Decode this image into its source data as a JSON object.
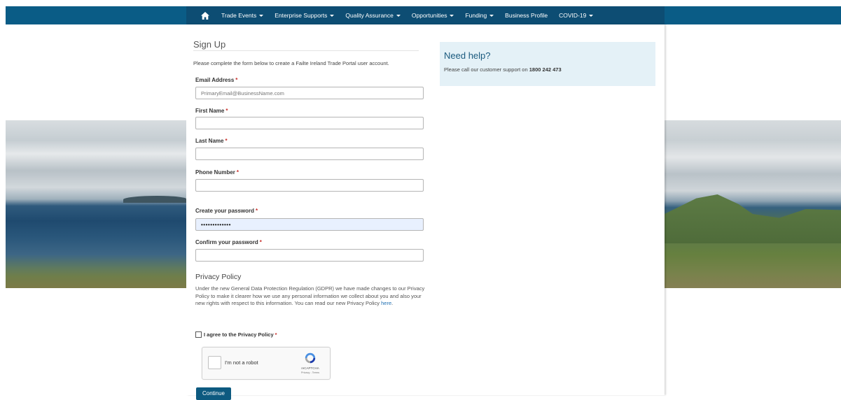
{
  "nav": {
    "home_icon": "home-icon",
    "items": [
      {
        "label": "Trade Events",
        "dropdown": true
      },
      {
        "label": "Enterprise Supports",
        "dropdown": true
      },
      {
        "label": "Quality Assurance",
        "dropdown": true
      },
      {
        "label": "Opportunities",
        "dropdown": true
      },
      {
        "label": "Funding",
        "dropdown": true
      },
      {
        "label": "Business Profile",
        "dropdown": false
      },
      {
        "label": "COVID-19",
        "dropdown": true
      }
    ]
  },
  "form": {
    "title": "Sign Up",
    "intro": "Please complete the form below to create a Failte Ireland Trade Portal user account.",
    "required_marker": "*",
    "email": {
      "label": "Email Address",
      "placeholder": "PrimaryEmail@BusinessName.com",
      "value": ""
    },
    "first_name": {
      "label": "First Name",
      "value": ""
    },
    "last_name": {
      "label": "Last Name",
      "value": ""
    },
    "phone": {
      "label": "Phone Number",
      "value": ""
    },
    "password": {
      "label": "Create your password",
      "value": "•••••••••••••"
    },
    "confirm_password": {
      "label": "Confirm your password",
      "value": ""
    }
  },
  "privacy": {
    "title": "Privacy Policy",
    "text": "Under the new General Data Protection Regulation (GDPR) we have made changes to our Privacy Policy to make it clearer how we use any personal information we collect about you and also your new rights with respect to this information. You can read our new Privacy Policy",
    "link": "here",
    "agree_label": "I agree to the Privacy Policy",
    "required_marker": "*"
  },
  "recaptcha": {
    "label": "I'm not a robot",
    "brand": "reCAPTCHA",
    "sub": "Privacy - Terms"
  },
  "continue_label": "Continue",
  "help": {
    "title": "Need help?",
    "text": "Please call our customer support on",
    "phone": "1800 242 473"
  },
  "colors": {
    "nav_outer": "#0a5c86",
    "nav_inner": "#0d4d73",
    "help_bg": "#e4f1f7",
    "accent": "#1a5a7e",
    "required": "#c9302c",
    "button": "#0d5a80"
  }
}
